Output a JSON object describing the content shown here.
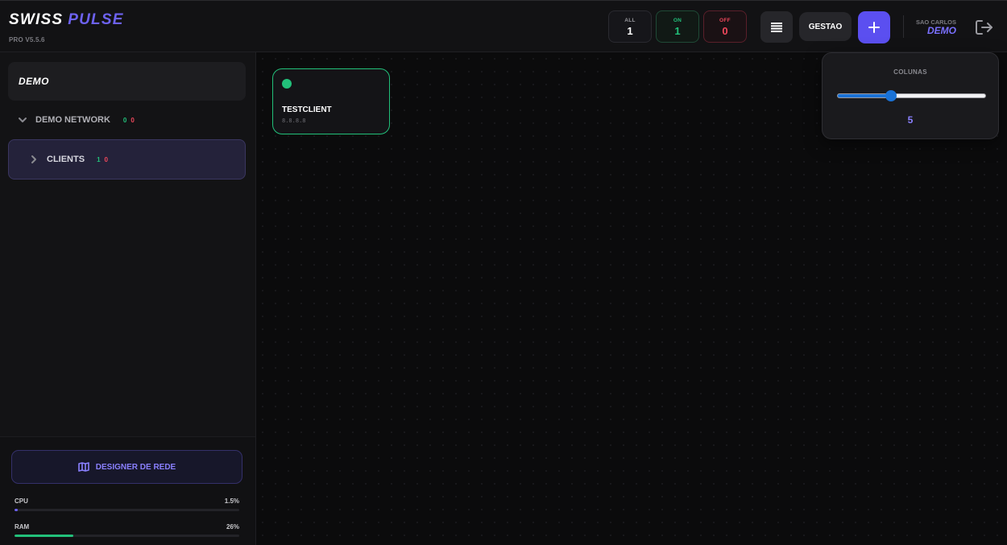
{
  "app": {
    "name_part1": "SWISS",
    "name_part2": "PULSE",
    "version": "PRO V5.5.6"
  },
  "header": {
    "stats": {
      "all": {
        "label": "ALL",
        "value": "1"
      },
      "on": {
        "label": "ON",
        "value": "1"
      },
      "off": {
        "label": "OFF",
        "value": "0"
      }
    },
    "menu_icon": "list-icon",
    "gestao_label": "GESTAO",
    "add_icon": "plus-icon",
    "user_location": "SAO CARLOS",
    "user_name": "DEMO",
    "logout_icon": "logout-icon"
  },
  "sidebar": {
    "org_name": "DEMO",
    "network": {
      "label": "DEMO NETWORK",
      "on": "0",
      "off": "0",
      "icon": "chevron-down-icon"
    },
    "group": {
      "label": "CLIENTS",
      "on": "1",
      "off": "0",
      "icon": "chevron-right-icon"
    },
    "designer_label": "DESIGNER DE REDE",
    "designer_icon": "map-icon",
    "metrics": {
      "cpu": {
        "label": "CPU",
        "value": "1.5%",
        "percent": 1.5
      },
      "ram": {
        "label": "RAM",
        "value": "26%",
        "percent": 26
      }
    }
  },
  "devices": [
    {
      "name": "TESTCLIENT",
      "ip": "8.8.8.8",
      "status": "online"
    }
  ],
  "columns_popover": {
    "title": "COLUNAS",
    "value": "5",
    "min": 1,
    "max": 12,
    "current": 5
  },
  "colors": {
    "accent": "#5b4ff0",
    "online": "#22c07a",
    "offline": "#f0485c"
  }
}
